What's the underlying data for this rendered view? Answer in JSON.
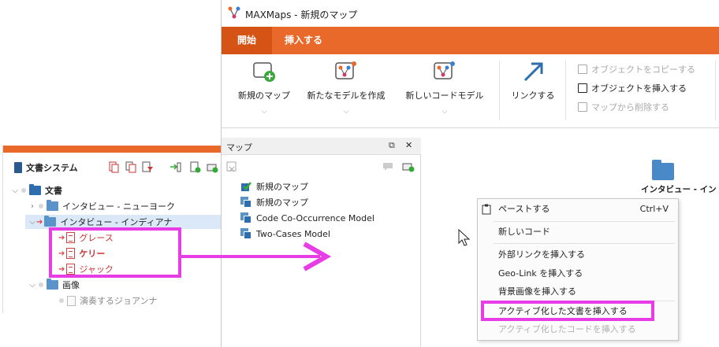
{
  "doc_system": {
    "title": "文書システム",
    "tree": [
      {
        "label": "文書"
      },
      {
        "label": "インタビュー - ニューヨーク"
      },
      {
        "label": "インタビュー - インディアナ"
      },
      {
        "label": "グレース"
      },
      {
        "label": "ケリー"
      },
      {
        "label": "ジャック"
      },
      {
        "label": "画像"
      },
      {
        "label": "演奏するジョアンナ"
      }
    ]
  },
  "window": {
    "title": "MAXMaps - 新規のマップ",
    "tabs": [
      {
        "label": "開始"
      },
      {
        "label": "挿入する"
      }
    ],
    "ribbon": {
      "new_map": "新規のマップ",
      "new_model": "新たなモデルを作成",
      "new_code_model": "新しいコードモデル",
      "link": "リンクする",
      "copy_object": "オブジェクトをコピーする",
      "insert_object": "オブジェクトを挿入する",
      "delete_from_map": "マップから削除する"
    }
  },
  "map_panel": {
    "title": "マップ",
    "pin_glyph": "⧉",
    "close_glyph": "✕",
    "items": [
      {
        "label": "新規のマップ"
      },
      {
        "label": "新規のマップ"
      },
      {
        "label": "Code Co-Occurrence Model"
      },
      {
        "label": "Two-Cases Model"
      }
    ]
  },
  "canvas": {
    "node_label": "インタビュー - イン"
  },
  "context_menu": {
    "items": [
      {
        "label": "ペーストする",
        "shortcut": "Ctrl+V"
      },
      {
        "label": "新しいコード"
      },
      {
        "label": "外部リンクを挿入する"
      },
      {
        "label": "Geo-Link を挿入する"
      },
      {
        "label": "背景画像を挿入する"
      },
      {
        "label": "アクティブ化した文書を挿入する"
      },
      {
        "label": "アクティブ化したコードを挿入する"
      }
    ]
  },
  "colors": {
    "ribbon_orange": "#e8692a",
    "highlight_magenta": "#e83de6",
    "folder_blue": "#2f6eae"
  }
}
